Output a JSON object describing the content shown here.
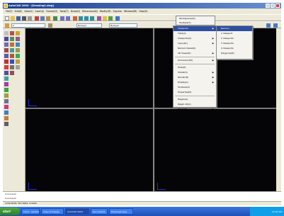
{
  "window": {
    "title": "AutoCAD 2004 - [Drawing1.dwg]"
  },
  "menubar": {
    "items": [
      "File(F)",
      "Edit(E)",
      "View(V)",
      "Insert(I)",
      "Format(O)",
      "Tools(T)",
      "Draw(D)",
      "Dimension(N)",
      "Modify(M)",
      "Express",
      "Window(W)",
      "Help(H)"
    ]
  },
  "toolbar": {
    "layer_combo": "0",
    "color_combo": "ByLayer",
    "linetype_combo": "ByLayer"
  },
  "submenu": {
    "items": [
      "Workspaces(O)",
      "Toolbars(T)"
    ]
  },
  "dropdown": {
    "items": [
      {
        "label": "Viewports",
        "arrow": "▶"
      },
      {
        "label": "Tiled(A)",
        "arrow": ""
      },
      {
        "label": "Viewports(V)",
        "arrow": "▶"
      },
      {
        "label": "Layout(L)",
        "arrow": "▶"
      },
      {
        "label": "Named Views(N)",
        "arrow": ""
      },
      {
        "label": "3D Views(D)",
        "arrow": "▶"
      },
      {
        "label": "Dimension(M)",
        "arrow": "▶"
      },
      {
        "label": "Hide(H)",
        "arrow": ""
      },
      {
        "label": "Shade(S)",
        "arrow": "▶"
      },
      {
        "label": "Render(R)",
        "arrow": "▶"
      },
      {
        "label": "Display(L)",
        "arrow": "▶"
      },
      {
        "label": "Toolbars(O)",
        "arrow": ""
      },
      {
        "label": "Properties(P)",
        "arrow": ""
      },
      {
        "label": "Regen(G)",
        "arrow": ""
      },
      {
        "label": "Regen All(A)",
        "arrow": ""
      },
      {
        "label": "Zoom(Z)",
        "arrow": "▶"
      }
    ]
  },
  "flyout": {
    "items": [
      "Named...",
      "1 Viewport",
      "2 Viewports",
      "3 Viewports",
      "4 Viewports",
      "Polygonal(P)",
      "Object(O)"
    ]
  },
  "command": {
    "line1": "Command:",
    "line2": "Command:"
  },
  "statusbar": {
    "coords": "1234.5678, 567.8901, 0.0000"
  },
  "taskbar": {
    "start": "start",
    "tasks": [
      "Inbox - Outlook",
      "Copy of Design",
      "AutoCAD 2004",
      "Document1",
      "Drawing1.dwg"
    ],
    "clock": "10:35 AM"
  }
}
